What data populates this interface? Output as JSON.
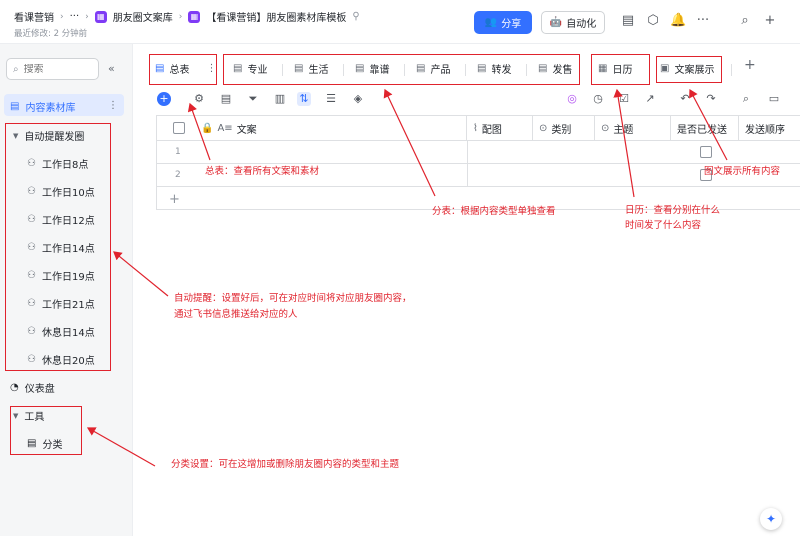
{
  "header": {
    "crumb_root": "看课营销",
    "crumb_ellipsis": "···",
    "crumb_folder": "朋友圈文案库",
    "doc_title": "【看课营销】朋友圈素材库模板",
    "last_edit": "最近修改: 2 分钟前",
    "share_label": "分享",
    "automation_label": "自动化"
  },
  "sidebar": {
    "search_placeholder": "搜索",
    "active_item": "内容素材库",
    "group_auto": "自动提醒发圈",
    "auto_items": [
      "工作日8点",
      "工作日10点",
      "工作日12点",
      "工作日14点",
      "工作日19点",
      "工作日21点",
      "休息日14点",
      "休息日20点"
    ],
    "dashboard": "仪表盘",
    "group_tools": "工具",
    "tools_items": [
      "分类"
    ]
  },
  "tabs": {
    "main": "总表",
    "categories": [
      "专业",
      "生活",
      "靠谱",
      "产品",
      "转发",
      "发售"
    ],
    "calendar": "日历",
    "gallery": "文案展示",
    "add": "+"
  },
  "grid": {
    "columns": [
      "文案",
      "配图",
      "类别",
      "主题",
      "是否已发送",
      "发送顺序"
    ],
    "rows": [
      "1",
      "2"
    ]
  },
  "annotations": {
    "main_table": "总表：查看所有文案和素材",
    "category_tables": "分表：根据内容类型单独查看",
    "calendar_1": "日历：查看分别在什么",
    "calendar_2": "时间发了什么内容",
    "gallery": "图文展示所有内容",
    "reminder_1": "自动提醒：设置好后，可在对应时间将对应朋友圈内容，",
    "reminder_2": "通过飞书信息推送给对应的人",
    "classify": "分类设置：可在这增加或删除朋友圈内容的类型和主题"
  },
  "colors": {
    "accent": "#3370ff",
    "annotation_red": "#e0232d",
    "doc_badge": "#7f3bf5"
  }
}
